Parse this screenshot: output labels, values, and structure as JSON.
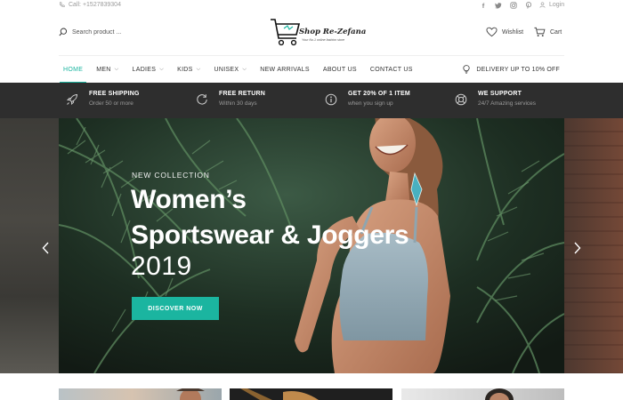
{
  "topbar": {
    "phone": "Call: +1527839304",
    "social": [
      "f",
      "t",
      "ig",
      "p"
    ],
    "login": "Login"
  },
  "header": {
    "search_placeholder": "Search product ...",
    "logo_name": "Shop Re-Zefana",
    "logo_tagline": "Your No.1 online fashion store",
    "wishlist": "Wishlist",
    "cart": "Cart"
  },
  "nav": {
    "items": [
      {
        "label": "HOME"
      },
      {
        "label": "MEN"
      },
      {
        "label": "LADIES"
      },
      {
        "label": "KIDS"
      },
      {
        "label": "UNISEX"
      },
      {
        "label": "NEW ARRIVALS"
      },
      {
        "label": "ABOUT US"
      },
      {
        "label": "CONTACT US"
      }
    ],
    "promo": "DELIVERY UP TO 10% OFF"
  },
  "features": [
    {
      "title": "FREE SHIPPING",
      "sub": "Order 50 or more",
      "icon": "rocket-icon"
    },
    {
      "title": "FREE RETURN",
      "sub": "Within 30 days",
      "icon": "refresh-icon"
    },
    {
      "title": "GET 20% OF 1 ITEM",
      "sub": "when you sign up",
      "icon": "info-icon"
    },
    {
      "title": "WE SUPPORT",
      "sub": "24/7 Amazing services",
      "icon": "lifebuoy-icon"
    }
  ],
  "hero": {
    "eyebrow": "NEW COLLECTION",
    "title_line1": "Women’s",
    "title_line2": "Sportswear & Joggers",
    "year": "2019",
    "cta": "DISCOVER NOW"
  },
  "colors": {
    "accent": "#1bb5a0",
    "strip": "#2e2e2e"
  }
}
